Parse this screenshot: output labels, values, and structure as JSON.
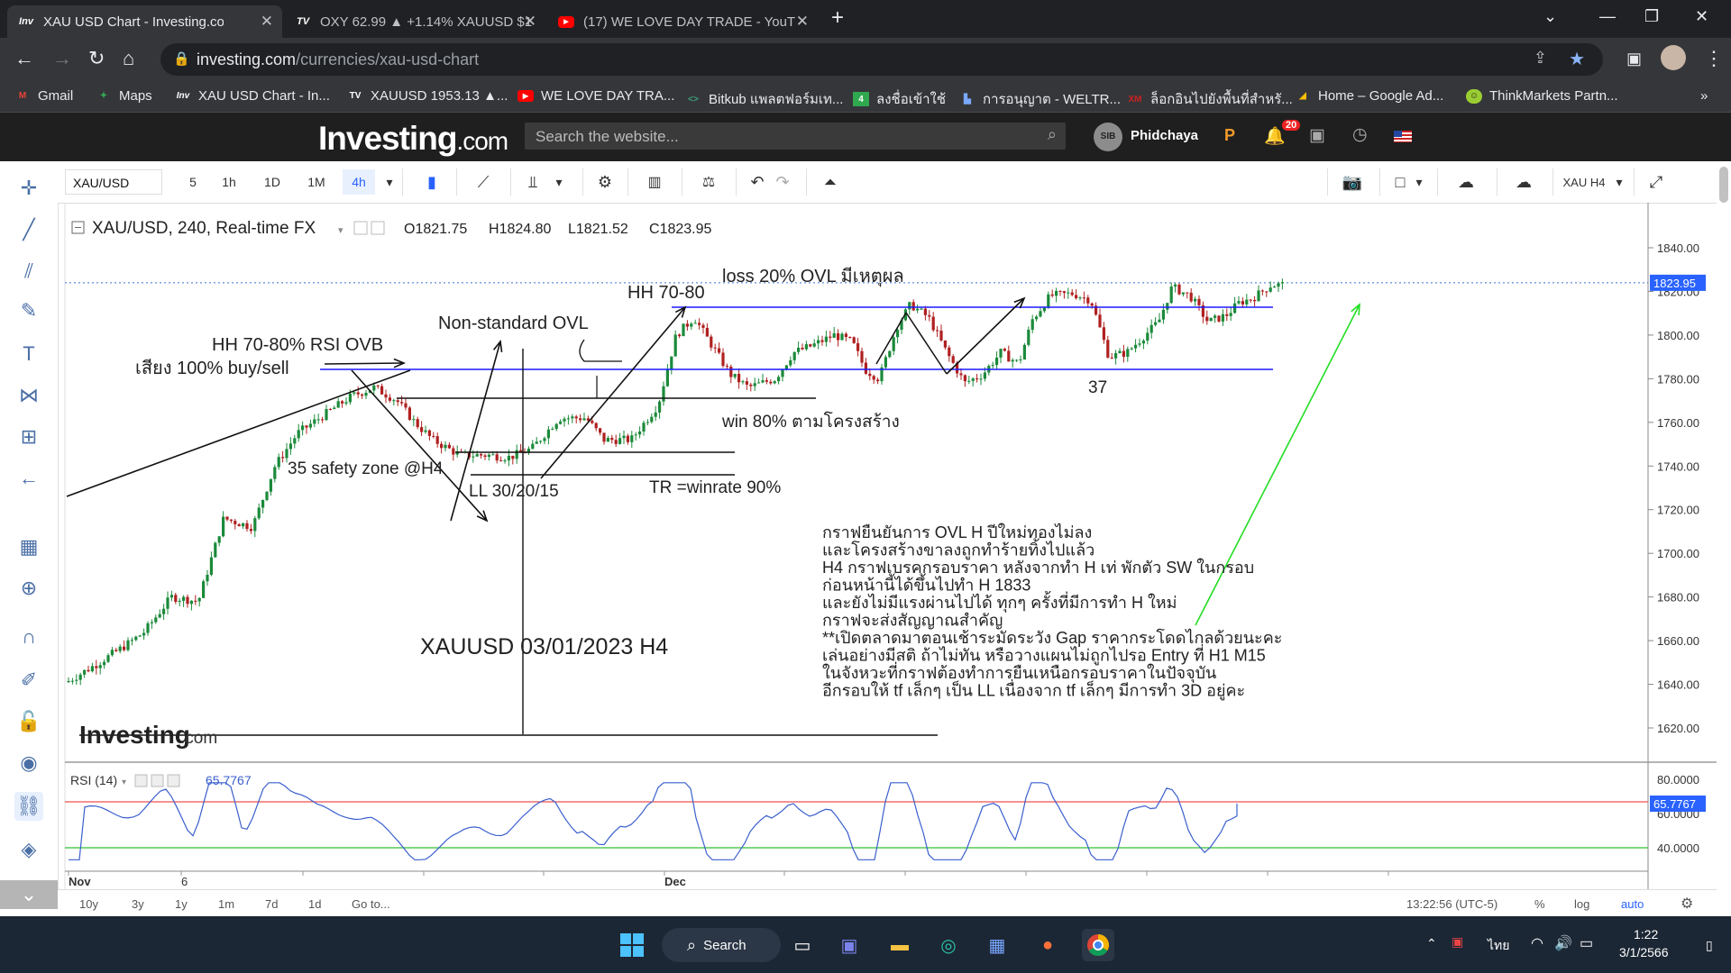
{
  "browser": {
    "tabs": [
      {
        "favicon": "Inv",
        "title": "XAU USD Chart - Investing.com",
        "active": true
      },
      {
        "favicon": "TV",
        "title": "OXY 62.99 ▲ +1.14% XAUUSD $1",
        "active": false
      },
      {
        "favicon": "YT",
        "title": "(17) WE LOVE DAY TRADE - YouT",
        "active": false
      }
    ],
    "new_tab": "+",
    "url_domain": "investing.com",
    "url_path": "/currencies/xau-usd-chart",
    "bookmarks": [
      {
        "icon": "gmail-icon",
        "label": "Gmail"
      },
      {
        "icon": "maps-icon",
        "label": "Maps"
      },
      {
        "icon": "investing-icon",
        "label": "XAU USD Chart - In..."
      },
      {
        "icon": "tradingview-icon",
        "label": "XAUUSD 1953.13 ▲..."
      },
      {
        "icon": "youtube-icon",
        "label": "WE LOVE DAY TRA..."
      },
      {
        "icon": "bitkub-icon",
        "label": "Bitkub แพลตฟอร์มเท..."
      },
      {
        "icon": "green-4-icon",
        "label": "ลงชื่อเข้าใช้"
      },
      {
        "icon": "weltrade-icon",
        "label": "การอนุญาต - WELTR..."
      },
      {
        "icon": "xm-icon",
        "label": "ล็อกอินไปยังพื้นที่สำหรั..."
      },
      {
        "icon": "google-ads-icon",
        "label": "Home – Google Ad..."
      },
      {
        "icon": "thinkmarkets-icon",
        "label": "ThinkMarkets Partn..."
      }
    ],
    "bookmarks_more": "»"
  },
  "site": {
    "logo_main": "Investing",
    "logo_suffix": ".com",
    "search_placeholder": "Search the website...",
    "user_name": "Phidchaya",
    "avatar_text": "SIB",
    "notification_count": "20"
  },
  "toolbar": {
    "symbol": "XAU/USD",
    "intervals": [
      "5",
      "1h",
      "1D",
      "1M",
      "4h"
    ],
    "active_interval": "4h",
    "layout_label": "XAU H4"
  },
  "chart": {
    "legend_title": "XAU/USD, 240, Real-time FX",
    "ohlc": {
      "o_label": "O",
      "o": "1821.75",
      "h_label": "H",
      "h": "1824.80",
      "l_label": "L",
      "l": "1821.52",
      "c_label": "C",
      "c": "1823.95"
    },
    "price_ticks": [
      "1840.00",
      "1820.00",
      "1800.00",
      "1780.00",
      "1760.00",
      "1740.00",
      "1720.00",
      "1700.00",
      "1680.00",
      "1660.00",
      "1640.00",
      "1620.00"
    ],
    "last_price": "1823.95",
    "rsi_label": "RSI (14)",
    "rsi_value": "65.7767",
    "rsi_ticks": [
      "80.0000",
      "60.0000",
      "40.0000"
    ],
    "x_labels": [
      "Nov",
      "6",
      "Dec"
    ],
    "watermark_main": "Investing",
    "watermark_suffix": ".com",
    "annotations": {
      "loss": "loss 20% OVL มีเหตุผล",
      "hh_right": "HH 70-80",
      "non_standard": "Non-standard OVL",
      "hh_left": "HH 70-80% RSI OVB",
      "risk": "เสียง 100%  buy/sell",
      "win": "win 80% ตามโครงสร้าง",
      "safety": "35 safety zone @H4",
      "ll": "LL 30/20/15",
      "tr": "TR =winrate 90%",
      "num37": "37",
      "title": "XAUUSD 03/01/2023 H4",
      "notes": [
        "กราฟยืนยันการ OVL H ปีใหม่ทองไม่ลง",
        "และโครงสร้างขาลงถูกทำร้ายทิ้งไปแล้ว",
        "H4 กราฟเบรคกรอบราคา หลังจากทำ H เท่ พักตัว SW ในกรอบ",
        "ก่อนหน้านี้ได้ขึ้นไปทำ H 1833",
        "และยังไม่มีแรงผ่านไปได้ ทุกๆ ครั้งที่มีการทำ H ใหม่",
        "กราฟจะส่งสัญญาณสำคัญ",
        "**เปิดตลาดมาตอนเช้าระมัดระวัง Gap ราคากระโดดไกลด้วยนะคะ",
        "เล่นอย่างมีสติ ถ้าไม่ทัน หรือวางแผนไม่ถูกไปรอ Entry ที่ H1 M15",
        "ในจังหวะที่กราฟต้องทำการยืนเหนือกรอบราคาในปัจจุบัน",
        "อีกรอบให้ tf เล็กๆ เป็น LL เนื่องจาก tf เล็กๆ มีการทำ 3D อยู่คะ"
      ]
    },
    "colors": {
      "up": "#1b8a3a",
      "down": "#b02020",
      "resistance": "#1a1aff",
      "rsi_line": "#3a5fcd",
      "rsi_upper": "#f05050",
      "rsi_lower": "#30c030",
      "arrow_green": "#22dd22"
    }
  },
  "bottom": {
    "ranges": [
      "10y",
      "3y",
      "1y",
      "1m",
      "7d",
      "1d",
      "Go to..."
    ],
    "time": "13:22:56 (UTC-5)",
    "opts": [
      "%",
      "log",
      "auto"
    ]
  },
  "taskbar": {
    "search_label": "Search",
    "lang": "ไทย",
    "time": "1:22",
    "date": "3/1/2566"
  }
}
